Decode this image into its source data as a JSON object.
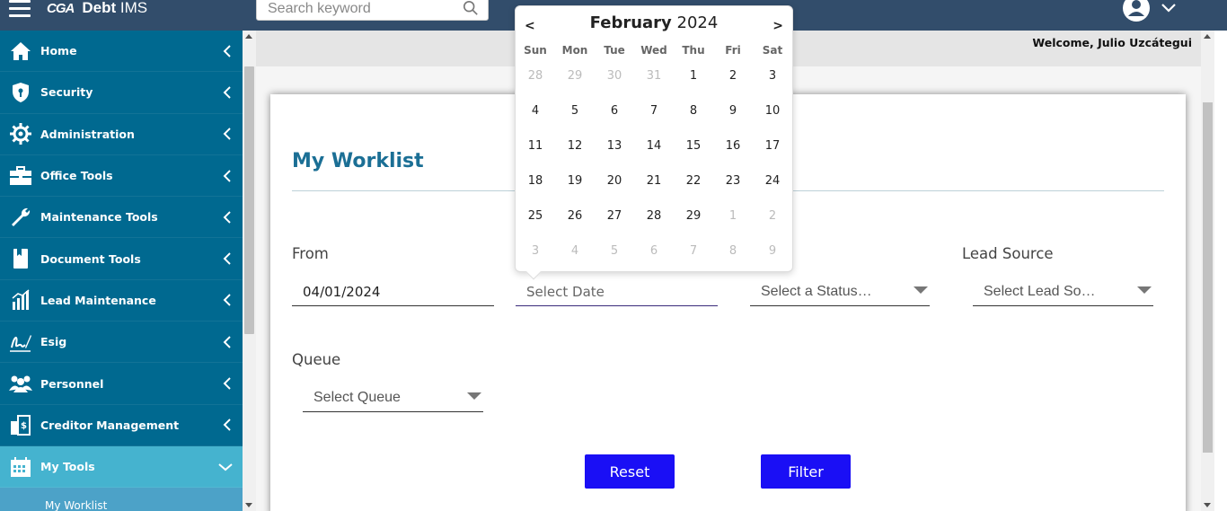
{
  "header": {
    "logo_mark": "CGA",
    "app_name_bold": "Debt",
    "app_name": " IMS",
    "search_placeholder": "Search keyword"
  },
  "sidebar": {
    "items": [
      {
        "label": "Home",
        "icon": "home-icon"
      },
      {
        "label": "Security",
        "icon": "shield-icon"
      },
      {
        "label": "Administration",
        "icon": "gear-icon"
      },
      {
        "label": "Office Tools",
        "icon": "toolbox-icon"
      },
      {
        "label": "Maintenance Tools",
        "icon": "wrench-icon"
      },
      {
        "label": "Document Tools",
        "icon": "book-icon"
      },
      {
        "label": "Lead Maintenance",
        "icon": "chart-icon"
      },
      {
        "label": "Esig",
        "icon": "signature-icon"
      },
      {
        "label": "Personnel",
        "icon": "people-icon"
      },
      {
        "label": "Creditor Management",
        "icon": "building-dollar-icon"
      },
      {
        "label": "My Tools",
        "icon": "calendar-icon"
      }
    ],
    "sub_items": [
      {
        "label": "My Worklist"
      }
    ]
  },
  "welcome": "Welcome, Julio Uzcátegui",
  "page": {
    "title": "My Worklist",
    "from_label": "From",
    "from_value": "04/01/2024",
    "to_placeholder": "Select Date",
    "status_placeholder": "Select a Status…",
    "lead_source_label": "Lead Source",
    "lead_source_placeholder": "Select Lead So…",
    "queue_label": "Queue",
    "queue_placeholder": "Select Queue",
    "reset_label": "Reset",
    "filter_label": "Filter"
  },
  "datepicker": {
    "month": "February",
    "year": "2024",
    "prev": "<",
    "next": ">",
    "weekdays": [
      "Sun",
      "Mon",
      "Tue",
      "Wed",
      "Thu",
      "Fri",
      "Sat"
    ],
    "weeks": [
      [
        {
          "d": "28",
          "o": true
        },
        {
          "d": "29",
          "o": true
        },
        {
          "d": "30",
          "o": true
        },
        {
          "d": "31",
          "o": true
        },
        {
          "d": "1"
        },
        {
          "d": "2"
        },
        {
          "d": "3"
        }
      ],
      [
        {
          "d": "4"
        },
        {
          "d": "5"
        },
        {
          "d": "6"
        },
        {
          "d": "7"
        },
        {
          "d": "8"
        },
        {
          "d": "9"
        },
        {
          "d": "10"
        }
      ],
      [
        {
          "d": "11"
        },
        {
          "d": "12"
        },
        {
          "d": "13"
        },
        {
          "d": "14"
        },
        {
          "d": "15"
        },
        {
          "d": "16"
        },
        {
          "d": "17"
        }
      ],
      [
        {
          "d": "18"
        },
        {
          "d": "19"
        },
        {
          "d": "20"
        },
        {
          "d": "21"
        },
        {
          "d": "22"
        },
        {
          "d": "23"
        },
        {
          "d": "24"
        }
      ],
      [
        {
          "d": "25"
        },
        {
          "d": "26"
        },
        {
          "d": "27"
        },
        {
          "d": "28"
        },
        {
          "d": "29"
        },
        {
          "d": "1",
          "o": true
        },
        {
          "d": "2",
          "o": true
        }
      ],
      [
        {
          "d": "3",
          "o": true
        },
        {
          "d": "4",
          "o": true
        },
        {
          "d": "5",
          "o": true
        },
        {
          "d": "6",
          "o": true
        },
        {
          "d": "7",
          "o": true
        },
        {
          "d": "8",
          "o": true
        },
        {
          "d": "9",
          "o": true
        }
      ]
    ]
  },
  "colors": {
    "header_bg": "#324d6b",
    "sidebar_bg": "#006990",
    "sidebar_active": "#45b3cf",
    "title": "#1b6f95",
    "button": "#1a0ff5"
  }
}
